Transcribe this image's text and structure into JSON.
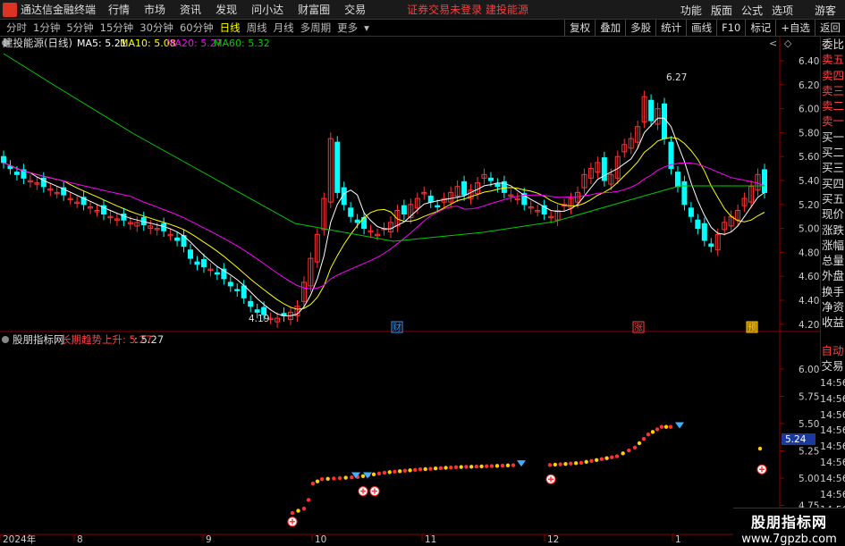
{
  "menubar": {
    "app_title": "通达信金融终端",
    "items": [
      "行情",
      "市场",
      "资讯",
      "发现",
      "问小达",
      "财富圈",
      "交易"
    ],
    "warning": "证券交易未登录  建投能源",
    "right_items": [
      "功能",
      "版面",
      "公式",
      "选项",
      "游客"
    ]
  },
  "periods": {
    "items": [
      "分时",
      "1分钟",
      "5分钟",
      "15分钟",
      "30分钟",
      "60分钟",
      "日线",
      "周线",
      "月线",
      "多周期",
      "更多"
    ],
    "active": "日线",
    "tools": [
      "复权",
      "叠加",
      "多股",
      "统计",
      "画线",
      "F10",
      "标记",
      "+自选",
      "返回"
    ]
  },
  "main_chart": {
    "title": "建投能源(日线)",
    "ma": [
      {
        "label": "MA5: 5.21",
        "color": "#ffffff"
      },
      {
        "label": "MA10: 5.08",
        "color": "#ffff00"
      },
      {
        "label": "MA20: 5.27",
        "color": "#ff00ff"
      },
      {
        "label": "MA60: 5.32",
        "color": "#00cc00"
      }
    ],
    "price_ticks": [
      "6.40",
      "6.20",
      "6.00",
      "5.80",
      "5.60",
      "5.40",
      "5.20",
      "5.00",
      "4.80",
      "4.60",
      "4.40",
      "4.20"
    ],
    "high_label": "6.27",
    "low_label": "4.19",
    "badges": [
      {
        "text": "财",
        "color": "#3399ff"
      },
      {
        "text": "涨",
        "color": "#ff4040"
      },
      {
        "text": "预",
        "color": "#ffcc00"
      }
    ],
    "colors": {
      "up": "#ff3333",
      "down": "#00ffff",
      "ma5": "#ffffff",
      "ma10": "#ffff00",
      "ma20": "#ff00ff",
      "ma60": "#00cc00"
    }
  },
  "side_panel": {
    "items": [
      "委比",
      "卖五",
      "卖四",
      "卖三",
      "卖二",
      "卖一",
      "买一",
      "买二",
      "买三",
      "买四",
      "买五",
      "现价",
      "涨跌",
      "涨幅",
      "总量",
      "外盘",
      "换手",
      "净资",
      "收益"
    ],
    "red_items": [
      "卖五",
      "卖四",
      "卖三",
      "卖二",
      "卖一"
    ],
    "bottom_items": [
      "自动",
      "交易"
    ]
  },
  "indicator": {
    "title": "股朋指标网",
    "label": "长期趋势上升: 5.27",
    "value": ": 5.27",
    "ticks": [
      "6.00",
      "5.75",
      "5.50",
      "5.25",
      "5.00",
      "4.75"
    ],
    "current_badge": "5.24"
  },
  "timeline": [
    "14:56",
    "14:56",
    "14:56",
    "14:56",
    "14:56",
    "14:56",
    "14:56",
    "14:56",
    "14:56",
    "14:56"
  ],
  "xaxis": {
    "labels": [
      "2024年",
      "8",
      "9",
      "10",
      "11",
      "12",
      "1"
    ]
  },
  "watermark": {
    "line1": "股朋指标网",
    "line2": "www.7gpzb.com"
  }
}
